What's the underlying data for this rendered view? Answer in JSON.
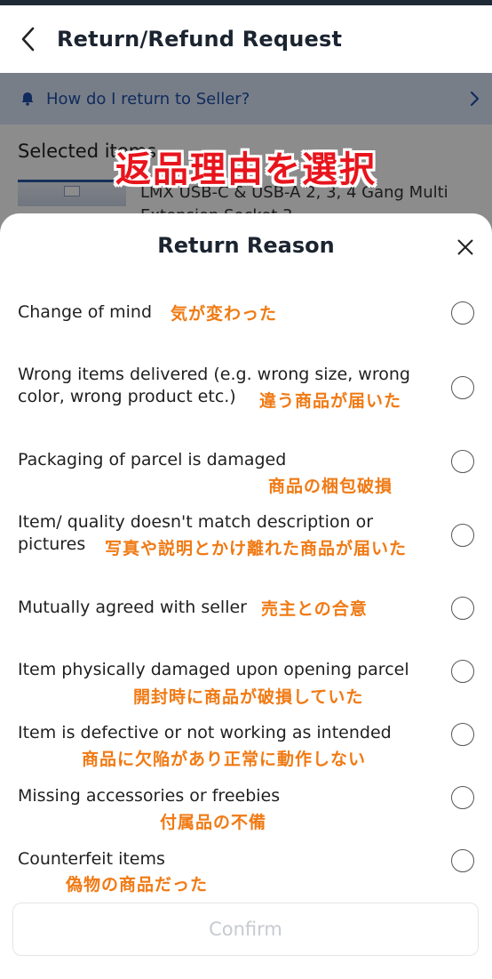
{
  "header": {
    "title": "Return/Refund Request"
  },
  "help": {
    "text": "How do I return to Seller?"
  },
  "selected": {
    "title": "Selected items",
    "product_name": "LMX USB-C & USB-A 2, 3, 4 Gang Multi Extension Socket 3"
  },
  "banner": {
    "text": "返品理由を選択"
  },
  "sheet": {
    "title": "Return Reason",
    "options": [
      {
        "label_line1": "Change of mind",
        "label_line2": "",
        "jp": "気が変わった"
      },
      {
        "label_line1": "Wrong items delivered (e.g. wrong size, wrong",
        "label_line2": "color, wrong product etc.)",
        "jp": "違う商品が届いた"
      },
      {
        "label_line1": "Packaging of parcel is damaged",
        "label_line2": "",
        "jp": "商品の梱包破損"
      },
      {
        "label_line1": "Item/ quality doesn't match description or",
        "label_line2": "pictures",
        "jp": "写真や説明とかけ離れた商品が届いた"
      },
      {
        "label_line1": "Mutually agreed with seller",
        "label_line2": "",
        "jp": "売主との合意"
      },
      {
        "label_line1": "Item physically damaged upon opening parcel",
        "label_line2": "",
        "jp": "開封時に商品が破損していた"
      },
      {
        "label_line1": "Item is defective or not working as intended",
        "label_line2": "",
        "jp": "商品に欠陥があり正常に動作しない"
      },
      {
        "label_line1": "Missing accessories or freebies",
        "label_line2": "",
        "jp": "付属品の不備"
      },
      {
        "label_line1": "Counterfeit items",
        "label_line2": "",
        "jp": "偽物の商品だった"
      }
    ],
    "confirm_label": "Confirm"
  },
  "colors": {
    "annotation": "#f07a14",
    "banner": "#e8141c",
    "help_bar": "#dbe6f7",
    "link": "#1e4fa8"
  },
  "icons": {
    "back": "chevron-left-icon",
    "bell": "bell-icon",
    "chevron": "chevron-right-icon",
    "close": "close-icon"
  }
}
